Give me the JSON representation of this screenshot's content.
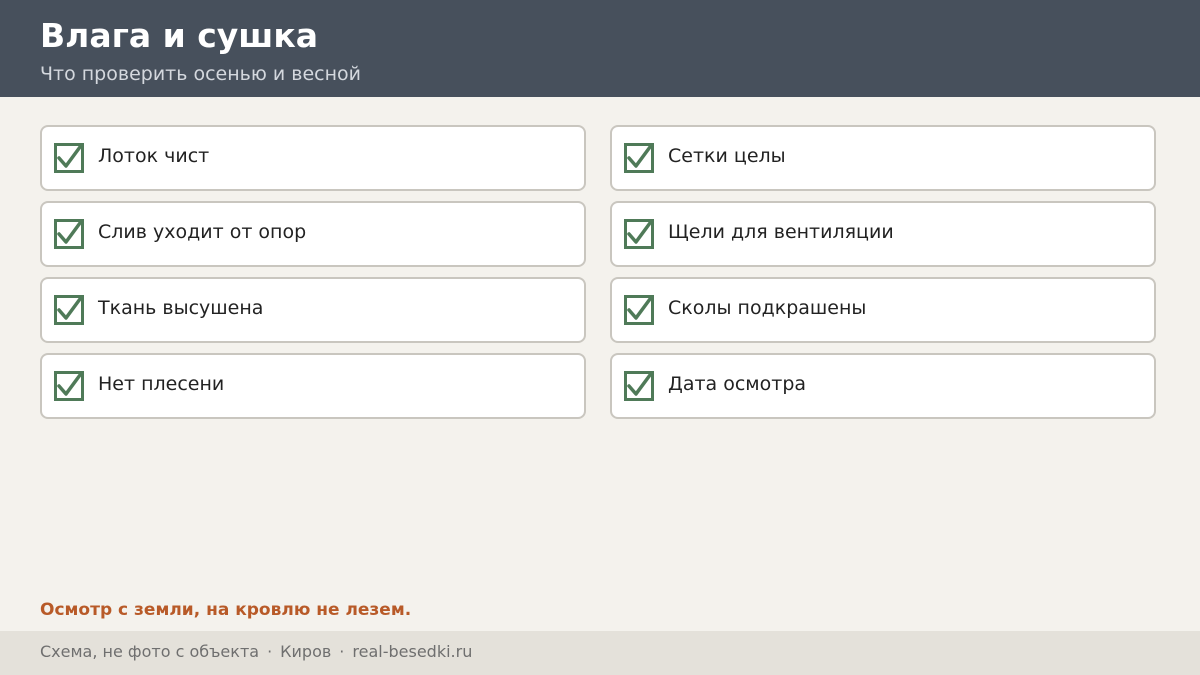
{
  "header": {
    "title": "Влага и сушка",
    "subtitle": "Что проверить осенью и весной"
  },
  "checklist": {
    "items": [
      {
        "label": "Лоток чист",
        "checked": true
      },
      {
        "label": "Сетки целы",
        "checked": true
      },
      {
        "label": "Слив уходит от опор",
        "checked": true
      },
      {
        "label": "Щели для вентиляции",
        "checked": true
      },
      {
        "label": "Ткань высушена",
        "checked": true
      },
      {
        "label": "Сколы подкрашены",
        "checked": true
      },
      {
        "label": "Нет плесени",
        "checked": true
      },
      {
        "label": "Дата осмотра",
        "checked": true
      }
    ]
  },
  "note": "Осмотр с земли, на кровлю не лезем.",
  "footer": {
    "caption": "Схема, не фото с объекта",
    "separator": "·",
    "city": "Киров",
    "site": "real-besedki.ru"
  },
  "colors": {
    "header_bg": "#47505c",
    "check_green": "#4f7a58",
    "note_orange": "#b85a28"
  }
}
